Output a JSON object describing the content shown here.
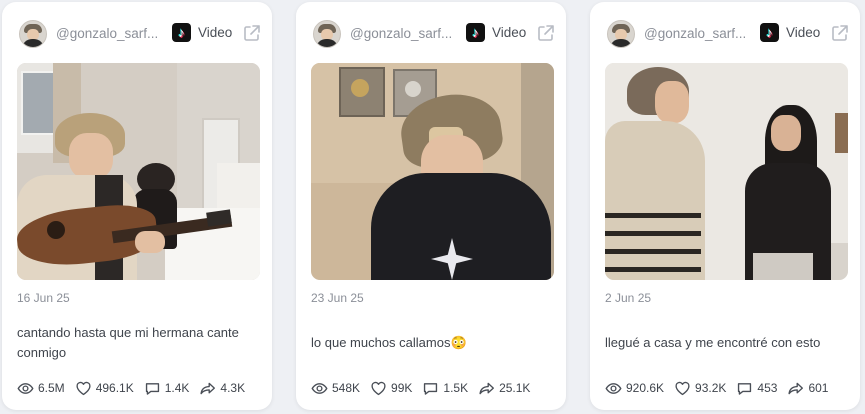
{
  "cards": [
    {
      "handle": "@gonzalo_sarf...",
      "platform_label": "Video",
      "date": "16 Jun 25",
      "caption": "cantando hasta que mi hermana cante conmigo",
      "stats": {
        "views": "6.5M",
        "likes": "496.1K",
        "comments": "1.4K",
        "shares": "4.3K"
      }
    },
    {
      "handle": "@gonzalo_sarf...",
      "platform_label": "Video",
      "date": "23 Jun 25",
      "caption": "lo que muchos callamos😳",
      "stats": {
        "views": "548K",
        "likes": "99K",
        "comments": "1.5K",
        "shares": "25.1K"
      }
    },
    {
      "handle": "@gonzalo_sarf...",
      "platform_label": "Video",
      "date": "2 Jun 25",
      "caption": "llegué a casa y me encontré con esto",
      "stats": {
        "views": "920.6K",
        "likes": "93.2K",
        "comments": "453",
        "shares": "601"
      }
    }
  ],
  "icons": {
    "platform": "tiktok-icon",
    "external": "external-link-icon",
    "views": "eye-icon",
    "likes": "heart-icon",
    "comments": "comment-icon",
    "shares": "share-icon"
  }
}
